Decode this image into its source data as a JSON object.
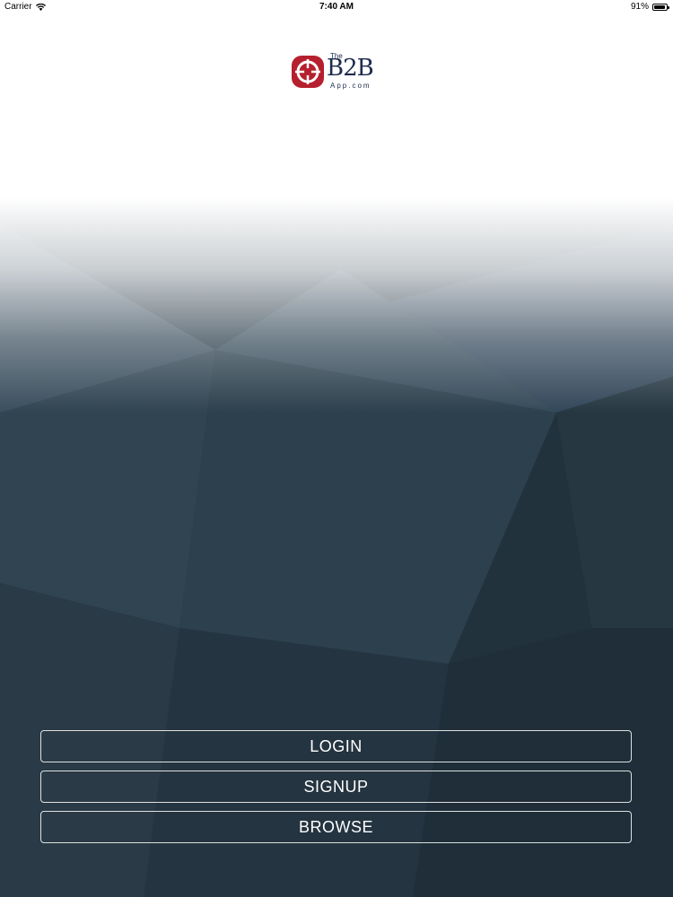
{
  "status_bar": {
    "carrier": "Carrier",
    "time": "7:40 AM",
    "battery_percent": "91%",
    "battery_level": 0.91
  },
  "logo": {
    "the": "The",
    "name": "B2B",
    "domain": "App.com",
    "brand_red": "#b51f2e",
    "brand_navy": "#1e2b4f"
  },
  "actions": {
    "login": "LOGIN",
    "signup": "SIGNUP",
    "browse": "BROWSE"
  },
  "colors": {
    "background_dark": "#22323d",
    "background_top": "#ffffff"
  },
  "icons": [
    "wifi-icon",
    "battery-icon",
    "logo-mark-icon"
  ]
}
